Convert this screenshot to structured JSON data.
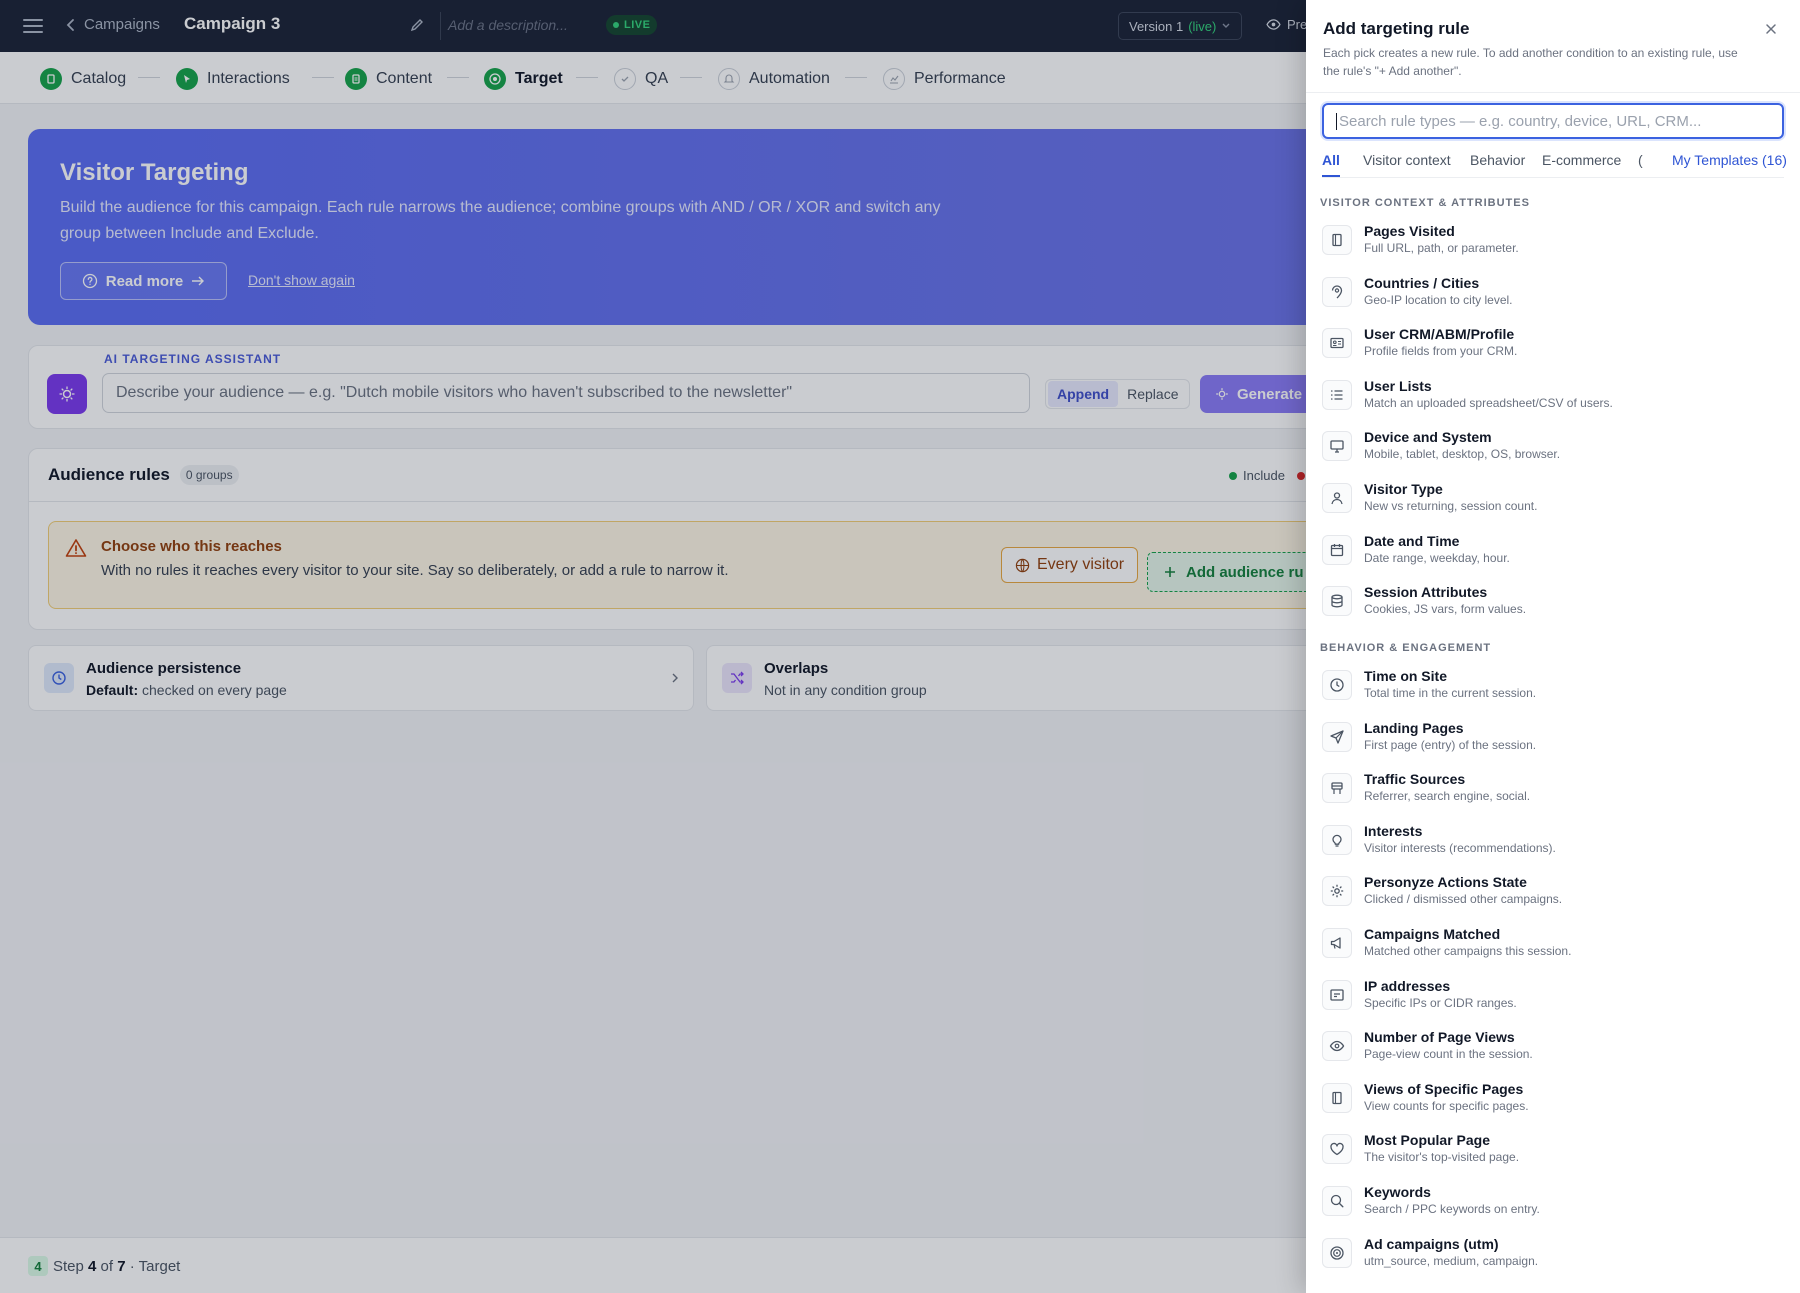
{
  "topbar": {
    "back_label": "Campaigns",
    "campaign_name": "Campaign 3",
    "description_placeholder": "Add a description...",
    "live_badge": "LIVE",
    "version_label": "Version 1",
    "version_status": "(live)",
    "preview_label": "Pre"
  },
  "steps": [
    {
      "label": "Catalog",
      "state": "done"
    },
    {
      "label": "Interactions",
      "state": "done"
    },
    {
      "label": "Content",
      "state": "done"
    },
    {
      "label": "Target",
      "state": "active"
    },
    {
      "label": "QA",
      "state": "todo"
    },
    {
      "label": "Automation",
      "state": "todo"
    },
    {
      "label": "Performance",
      "state": "todo"
    }
  ],
  "hero": {
    "title": "Visitor Targeting",
    "text": "Build the audience for this campaign. Each rule narrows the audience; combine groups with AND / OR / XOR and switch any group between Include and Exclude.",
    "read_more": "Read more",
    "dont_show": "Don't show again"
  },
  "ai": {
    "label": "AI TARGETING ASSISTANT",
    "placeholder": "Describe your audience — e.g. \"Dutch mobile visitors who haven't subscribed to the newsletter\"",
    "append": "Append",
    "replace": "Replace",
    "generate": "Generate"
  },
  "rules": {
    "title": "Audience rules",
    "group_count": "0 groups",
    "legend_include": "Include",
    "warn_title": "Choose who this reaches",
    "warn_text": "With no rules it reaches every visitor to your site. Say so deliberately, or add a rule to narrow it.",
    "every_visitor": "Every visitor",
    "add_audience": "Add audience ru"
  },
  "persistence": {
    "title": "Audience persistence",
    "default_label": "Default:",
    "default_value": "checked on every page"
  },
  "overlaps": {
    "title": "Overlaps",
    "subtitle": "Not in any condition group"
  },
  "footer": {
    "step_num": "4",
    "prefix": "Step",
    "current": "4",
    "of": "of",
    "total": "7",
    "suffix": "· Target"
  },
  "panel": {
    "title": "Add targeting rule",
    "subtitle": "Each pick creates a new rule. To add another condition to an existing rule, use the rule's \"+ Add another\".",
    "search_placeholder": "Search rule types — e.g. country, device, URL, CRM...",
    "tabs": [
      "All",
      "Visitor context",
      "Behavior",
      "E-commerce",
      "("
    ],
    "templates_tab": "My Templates (16)",
    "section_visitor": "VISITOR CONTEXT & ATTRIBUTES",
    "section_behavior": "BEHAVIOR & ENGAGEMENT",
    "visitor_items": [
      {
        "title": "Pages Visited",
        "desc": "Full URL, path, or parameter.",
        "icon": "pages-icon"
      },
      {
        "title": "Countries / Cities",
        "desc": "Geo-IP location to city level.",
        "icon": "location-pin-icon"
      },
      {
        "title": "User CRM/ABM/Profile",
        "desc": "Profile fields from your CRM.",
        "icon": "id-card-icon"
      },
      {
        "title": "User Lists",
        "desc": "Match an uploaded spreadsheet/CSV of users.",
        "icon": "list-icon"
      },
      {
        "title": "Device and System",
        "desc": "Mobile, tablet, desktop, OS, browser.",
        "icon": "monitor-icon"
      },
      {
        "title": "Visitor Type",
        "desc": "New vs returning, session count.",
        "icon": "person-icon"
      },
      {
        "title": "Date and Time",
        "desc": "Date range, weekday, hour.",
        "icon": "calendar-icon"
      },
      {
        "title": "Session Attributes",
        "desc": "Cookies, JS vars, form values.",
        "icon": "database-icon"
      }
    ],
    "behavior_items": [
      {
        "title": "Time on Site",
        "desc": "Total time in the current session.",
        "icon": "clock-icon"
      },
      {
        "title": "Landing Pages",
        "desc": "First page (entry) of the session.",
        "icon": "send-icon"
      },
      {
        "title": "Traffic Sources",
        "desc": "Referrer, search engine, social.",
        "icon": "signpost-icon"
      },
      {
        "title": "Interests",
        "desc": "Visitor interests (recommendations).",
        "icon": "lightbulb-icon"
      },
      {
        "title": "Personyze Actions State",
        "desc": "Clicked / dismissed other campaigns.",
        "icon": "gear-icon"
      },
      {
        "title": "Campaigns Matched",
        "desc": "Matched other campaigns this session.",
        "icon": "megaphone-icon"
      },
      {
        "title": "IP addresses",
        "desc": "Specific IPs or CIDR ranges.",
        "icon": "terminal-icon"
      },
      {
        "title": "Number of Page Views",
        "desc": "Page-view count in the session.",
        "icon": "eye-icon"
      },
      {
        "title": "Views of Specific Pages",
        "desc": "View counts for specific pages.",
        "icon": "pages-icon"
      },
      {
        "title": "Most Popular Page",
        "desc": "The visitor's top-visited page.",
        "icon": "heart-icon"
      },
      {
        "title": "Keywords",
        "desc": "Search / PPC keywords on entry.",
        "icon": "search-icon"
      },
      {
        "title": "Ad campaigns (utm)",
        "desc": "utm_source, medium, campaign.",
        "icon": "target-icon"
      }
    ]
  },
  "colors": {
    "topbar": "#1b2336",
    "accent_green": "#16a34a",
    "accent_blue": "#2f55d4",
    "hero": "#5b6df3",
    "warn_bg": "#fef7e4"
  }
}
